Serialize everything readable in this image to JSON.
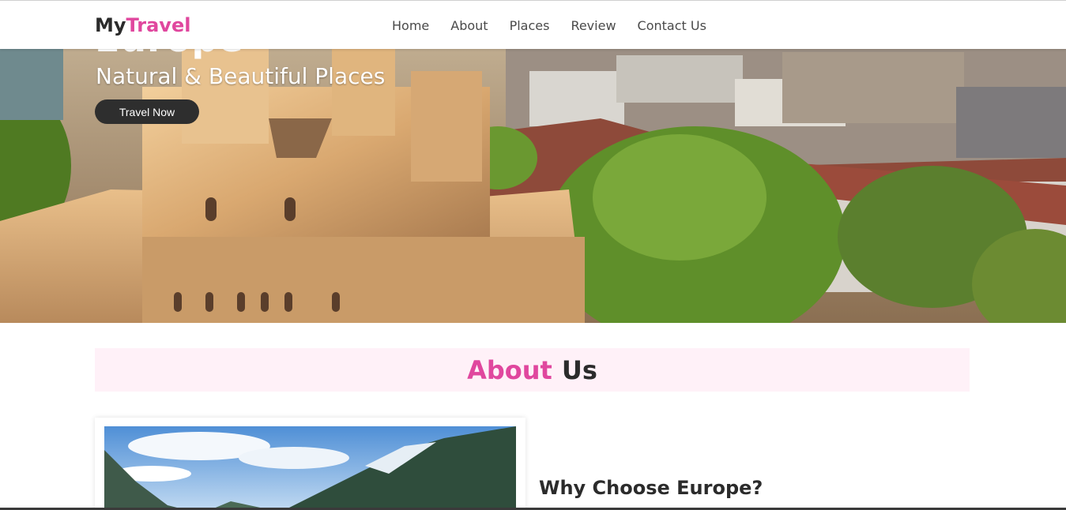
{
  "brand": {
    "name_part1": "My",
    "name_part2": "Travel",
    "accent_color": "#e0479e"
  },
  "nav": {
    "items": [
      {
        "label": "Home"
      },
      {
        "label": "About"
      },
      {
        "label": "Places"
      },
      {
        "label": "Review"
      },
      {
        "label": "Contact Us"
      }
    ]
  },
  "hero": {
    "title": "Europe",
    "subtitle": "Natural & Beautiful Places",
    "cta_label": "Travel Now",
    "cta_color": "#2e2e2e"
  },
  "about": {
    "heading_pink": "About",
    "heading_dark": "Us",
    "band_color": "#fff1f8"
  },
  "feature": {
    "title": "Why Choose Europe?"
  }
}
